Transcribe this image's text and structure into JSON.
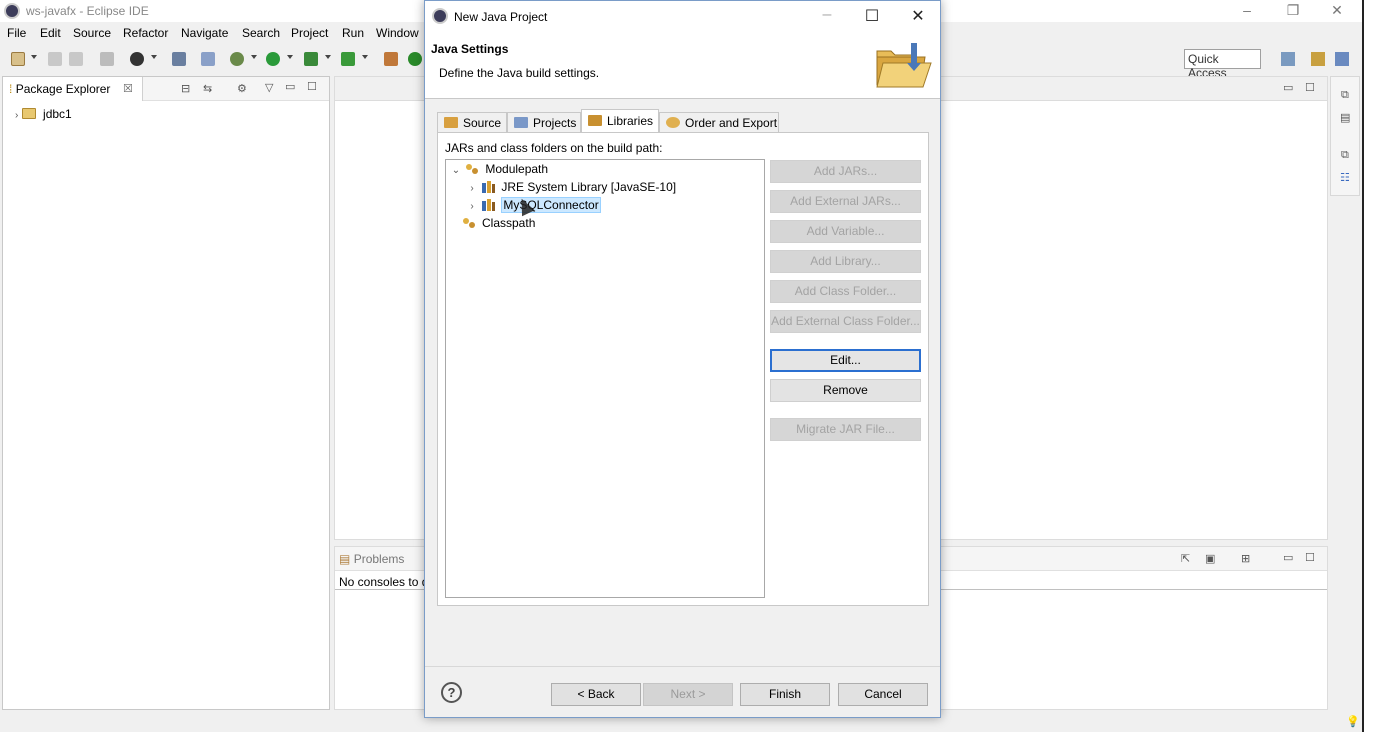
{
  "eclipse": {
    "window_title": "ws-javafx - Eclipse IDE",
    "menu": [
      "File",
      "Edit",
      "Source",
      "Refactor",
      "Navigate",
      "Search",
      "Project",
      "Run",
      "Window"
    ],
    "quick_access": "Quick Access",
    "package_explorer": {
      "tab_label": "Package Explorer",
      "close_glyph": "☒",
      "items": [
        {
          "label": "jdbc1"
        }
      ]
    },
    "console": {
      "tab_label": "Problems",
      "message": "No consoles to d"
    }
  },
  "dialog": {
    "title": "New Java Project",
    "header_title": "Java Settings",
    "header_desc": "Define the Java build settings.",
    "tabs": [
      {
        "label": "Source",
        "active": false
      },
      {
        "label": "Projects",
        "active": false
      },
      {
        "label": "Libraries",
        "active": true
      },
      {
        "label": "Order and Export",
        "active": false
      }
    ],
    "build_path_label": "JARs and class folders on the build path:",
    "tree": {
      "modulepath": "Modulepath",
      "jre": "JRE System Library [JavaSE-10]",
      "mysql": "MySQLConnector",
      "classpath": "Classpath"
    },
    "buttons": {
      "add_jars": "Add JARs...",
      "add_external_jars": "Add External JARs...",
      "add_variable": "Add Variable...",
      "add_library": "Add Library...",
      "add_class_folder": "Add Class Folder...",
      "add_external_class_folder": "Add External Class Folder...",
      "edit": "Edit...",
      "remove": "Remove",
      "migrate_jar": "Migrate JAR File..."
    },
    "footer": {
      "help": "?",
      "back": "< Back",
      "next": "Next >",
      "finish": "Finish",
      "cancel": "Cancel"
    }
  },
  "colors": {
    "selection": "#cce8ff",
    "focus_border": "#2b6fd0",
    "disabled_text": "#a3a3a3"
  }
}
